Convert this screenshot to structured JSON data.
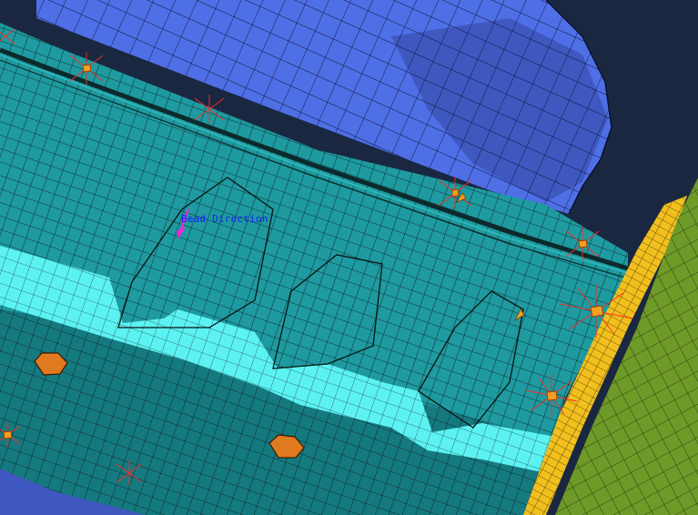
{
  "annotation": {
    "label": "Bead Direction"
  },
  "colors": {
    "background": "#1a2740",
    "upper_part_blue": "#4f6fe6",
    "upper_part_shadow": "#3f58c0",
    "plate_teal": "#1e9aa0",
    "plate_teal_dark": "#157a80",
    "bead_cyan": "#5df2f2",
    "weld_orange": "#e07a20",
    "flange_yellow": "#f2c01e",
    "side_green": "#6e9a28",
    "mesh_line": "#0a1414",
    "spot_marker_red": "#ff2a20",
    "bead_arrow_magenta": "#ff20e0",
    "annotation_text_blue": "#1a1aff"
  },
  "icons": [
    "bead-direction-arrow-icon",
    "spot-weld-marker-icon"
  ]
}
